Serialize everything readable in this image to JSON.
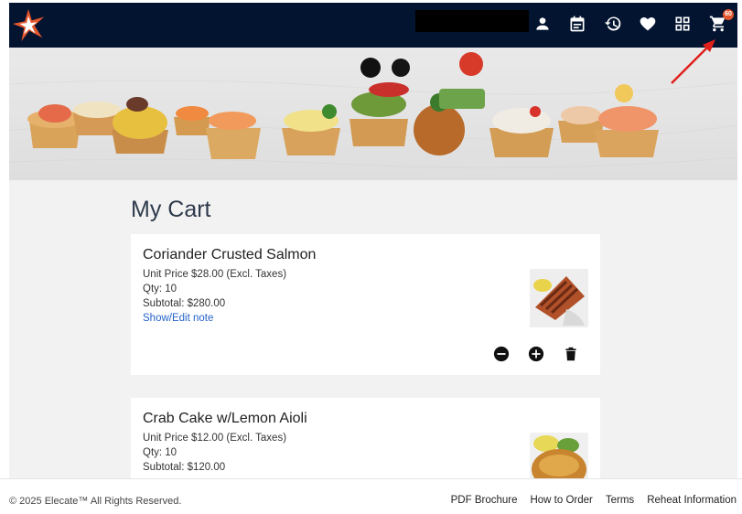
{
  "header": {
    "badge_count": "60",
    "icons": [
      "account-icon",
      "calendar-icon",
      "history-icon",
      "heart-icon",
      "grid-icon",
      "cart-icon"
    ]
  },
  "page": {
    "title": "My Cart"
  },
  "cart": {
    "items": [
      {
        "name": "Coriander Crusted Salmon",
        "unit_price": "Unit Price $28.00 (Excl. Taxes)",
        "qty": "Qty: 10",
        "subtotal": "Subtotal: $280.00",
        "note_link": "Show/Edit note"
      },
      {
        "name": "Crab Cake w/Lemon Aioli",
        "unit_price": "Unit Price $12.00 (Excl. Taxes)",
        "qty": "Qty: 10",
        "subtotal": "Subtotal: $120.00"
      }
    ]
  },
  "footer": {
    "copyright": "© 2025 Elecate™ All Rights Reserved.",
    "links": [
      "PDF Brochure",
      "How to Order",
      "Terms",
      "Reheat Information"
    ]
  },
  "colors": {
    "navbar": "#031430",
    "accent": "#e4572e",
    "link": "#2563c9"
  }
}
